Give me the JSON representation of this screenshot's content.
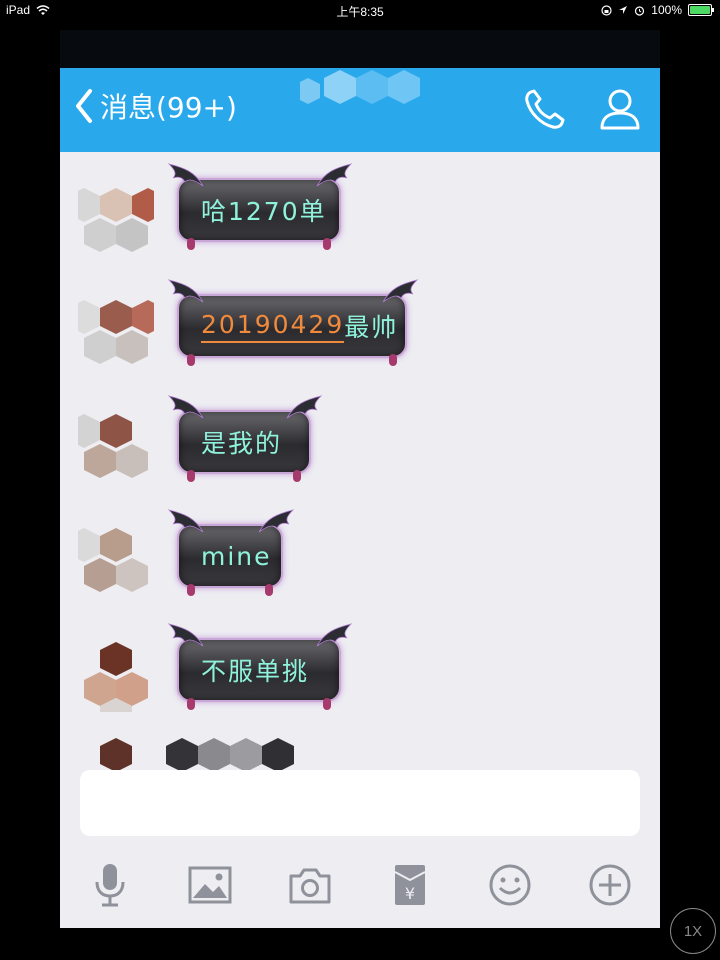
{
  "status_bar": {
    "device": "iPad",
    "time": "上午8:35",
    "battery": "100%",
    "battery_level": 1.0
  },
  "nav": {
    "back_label": "消息(99+)",
    "call_icon": "phone-icon",
    "profile_icon": "person-icon",
    "accent_color": "#2aa8ec"
  },
  "messages": [
    {
      "text": "哈1270单"
    },
    {
      "link_text": "20190429",
      "text": "最帅"
    },
    {
      "text": "是我的"
    },
    {
      "text": "mine"
    },
    {
      "text": "不服单挑"
    }
  ],
  "input": {
    "value": ""
  },
  "toolbar": {
    "icons": [
      "microphone-icon",
      "image-icon",
      "camera-icon",
      "red-packet-icon",
      "emoji-icon",
      "plus-icon"
    ]
  },
  "zoom_badge": "1X"
}
